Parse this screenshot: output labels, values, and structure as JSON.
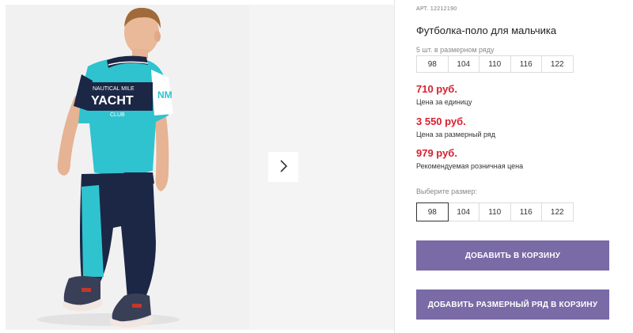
{
  "product": {
    "article": "АРТ. 12212190",
    "title": "Футболка-поло для мальчика"
  },
  "pack": {
    "label": "5 шт. в размерном ряду",
    "sizes": [
      "98",
      "104",
      "110",
      "116",
      "122"
    ]
  },
  "prices": [
    {
      "value": "710 руб.",
      "note": "Цена за единицу"
    },
    {
      "value": "3 550 руб.",
      "note": "Цена за размерный ряд"
    },
    {
      "value": "979 руб.",
      "note": "Рекомендуемая розничная цена"
    }
  ],
  "size_select": {
    "label": "Выберите размер:",
    "sizes": [
      "98",
      "104",
      "110",
      "116",
      "122"
    ],
    "selected": "98"
  },
  "buttons": {
    "add_to_cart": "ДОБАВИТЬ В КОРЗИНУ",
    "add_size_range": "ДОБАВИТЬ РАЗМЕРНЫЙ РЯД В КОРЗИНУ"
  },
  "shirt_print": {
    "line1": "NAUTICAL MILE",
    "line2": "YACHT",
    "line3": "CLUB",
    "sleeve": "NM"
  },
  "colors": {
    "accent_button": "#7a6aa6",
    "price": "#d8202f",
    "shirt": "#2fc3cf",
    "pants": "#1b2745"
  },
  "icons": {
    "next": "chevron-right-icon"
  }
}
